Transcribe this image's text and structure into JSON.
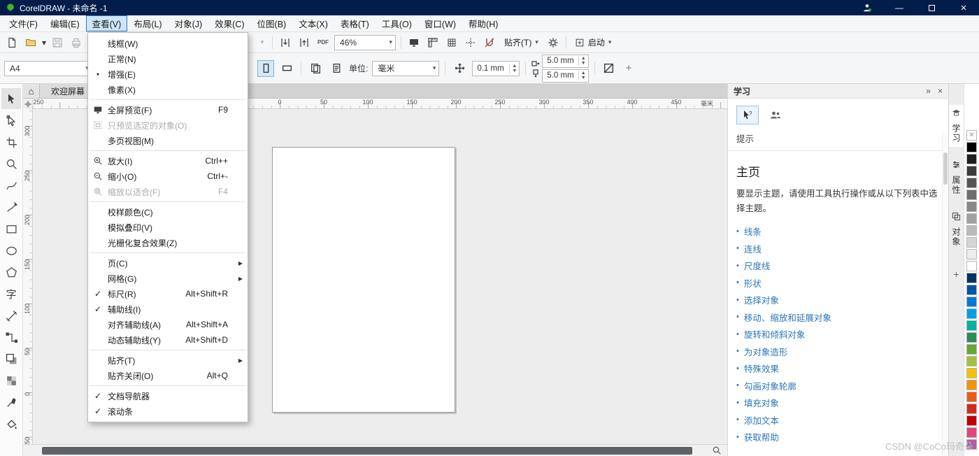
{
  "window": {
    "title": "CorelDRAW - 未命名 -1"
  },
  "glyphs": {
    "caret": "▾",
    "submenu": "▶",
    "check": "✓",
    "bullet": "●",
    "home": "⌂",
    "collapse": "»",
    "close": "×",
    "minimize": "—",
    "plus": "+",
    "swatch_none": "✕",
    "dot": "•"
  },
  "menubar": {
    "active": "查看(V)",
    "items": [
      {
        "label": "文件(F)"
      },
      {
        "label": "编辑(E)"
      },
      {
        "label": "查看(V)"
      },
      {
        "label": "布局(L)"
      },
      {
        "label": "对象(J)"
      },
      {
        "label": "效果(C)"
      },
      {
        "label": "位图(B)"
      },
      {
        "label": "文本(X)"
      },
      {
        "label": "表格(T)"
      },
      {
        "label": "工具(O)"
      },
      {
        "label": "窗口(W)"
      },
      {
        "label": "帮助(H)"
      }
    ]
  },
  "view_menu": {
    "items": [
      {
        "label": "线框(W)"
      },
      {
        "label": "正常(N)"
      },
      {
        "label": "增强(E)",
        "state": "bullet"
      },
      {
        "label": "像素(X)"
      },
      {
        "type": "sep"
      },
      {
        "label": "全屏预览(F)",
        "shortcut": "F9",
        "icon": "fullscreen"
      },
      {
        "label": "只预览选定的对象(O)",
        "icon": "preview-selected",
        "disabled": true
      },
      {
        "label": "多页视图(M)"
      },
      {
        "type": "sep"
      },
      {
        "label": "放大(I)",
        "shortcut": "Ctrl++",
        "icon": "zoom-in"
      },
      {
        "label": "缩小(O)",
        "shortcut": "Ctrl+-",
        "icon": "zoom-out"
      },
      {
        "label": "缩放以适合(F)",
        "shortcut": "F4",
        "icon": "zoom-fit",
        "disabled": true
      },
      {
        "type": "sep"
      },
      {
        "label": "校样颜色(C)"
      },
      {
        "label": "模拟叠印(V)"
      },
      {
        "label": "光栅化复合效果(Z)"
      },
      {
        "type": "sep"
      },
      {
        "label": "页(C)",
        "submenu": true
      },
      {
        "label": "网格(G)",
        "submenu": true
      },
      {
        "label": "标尺(R)",
        "shortcut": "Alt+Shift+R",
        "state": "check"
      },
      {
        "label": "辅助线(I)",
        "state": "check"
      },
      {
        "label": "对齐辅助线(A)",
        "shortcut": "Alt+Shift+A"
      },
      {
        "label": "动态辅助线(Y)",
        "shortcut": "Alt+Shift+D"
      },
      {
        "type": "sep"
      },
      {
        "label": "贴齐(T)",
        "submenu": true
      },
      {
        "label": "贴齐关闭(O)",
        "shortcut": "Alt+Q"
      },
      {
        "type": "sep"
      },
      {
        "label": "文档导航器",
        "state": "check"
      },
      {
        "label": "滚动条",
        "state": "check"
      }
    ]
  },
  "std_toolbar": {
    "zoom_value": "46%",
    "snap_label": "贴齐(T)",
    "launch_label": "启动",
    "pdf_label": "PDF"
  },
  "prop_bar": {
    "page_size": "A4",
    "units_label": "单位:",
    "units_value": "毫米",
    "nudge_value": "0.1 mm",
    "dup_x": "5.0 mm",
    "dup_y": "5.0 mm"
  },
  "doc_tabs": {
    "welcome": "欢迎屏幕"
  },
  "rulers": {
    "unit": "毫米",
    "top": [
      "250",
      "0",
      "50",
      "100",
      "150",
      "200",
      "250",
      "300",
      "350",
      "400",
      "450",
      "毫米"
    ],
    "left": [
      "300",
      "250",
      "200",
      "150",
      "100",
      "50",
      "0",
      "50"
    ]
  },
  "toolbox": [
    {
      "name": "pick-tool",
      "icon": "pick",
      "selected": true
    },
    {
      "name": "shape-tool",
      "icon": "shape"
    },
    {
      "name": "crop-tool",
      "icon": "crop"
    },
    {
      "name": "zoom-tool",
      "icon": "zoom"
    },
    {
      "name": "freehand-tool",
      "icon": "freehand"
    },
    {
      "name": "artistic-media-tool",
      "icon": "artistic"
    },
    {
      "name": "rectangle-tool",
      "icon": "rect"
    },
    {
      "name": "ellipse-tool",
      "icon": "ellipse"
    },
    {
      "name": "polygon-tool",
      "icon": "polygon"
    },
    {
      "name": "text-tool",
      "icon": "text",
      "glyph": "字"
    },
    {
      "name": "dimension-tool",
      "icon": "dimension"
    },
    {
      "name": "connector-tool",
      "icon": "connector"
    },
    {
      "name": "shadow-tool",
      "icon": "shadow"
    },
    {
      "name": "transparency-tool",
      "icon": "transparency"
    },
    {
      "name": "eyedropper-tool",
      "icon": "eyedropper"
    },
    {
      "name": "interactive-fill-tool",
      "icon": "fill"
    }
  ],
  "learn_panel": {
    "title": "学习",
    "hints_label": "提示",
    "home_title": "主页",
    "intro": "要显示主题，请使用工具执行操作或从以下列表中选择主题。",
    "links": [
      "线条",
      "连线",
      "尺度线",
      "形状",
      "选择对象",
      "移动、缩放和延展对象",
      "旋转和倾斜对象",
      "为对象造形",
      "特殊效果",
      "勾画对象轮廓",
      "填充对象",
      "添加文本",
      "获取帮助"
    ]
  },
  "side_tabs": [
    {
      "label": "学习",
      "icon": "learn-icon",
      "active": true
    },
    {
      "label": "属性",
      "icon": "properties-icon",
      "active": false
    },
    {
      "label": "对象",
      "icon": "objects-icon",
      "active": false
    }
  ],
  "palette": [
    "#000000",
    "#1f1f1f",
    "#3b3b3b",
    "#555555",
    "#6e6e6e",
    "#888888",
    "#a1a1a1",
    "#bababa",
    "#d4d4d4",
    "#ededed",
    "#ffffff",
    "#003366",
    "#0055a5",
    "#0078d4",
    "#00a0e9",
    "#00b0a0",
    "#2e8b57",
    "#66a832",
    "#a3c13a",
    "#f2c200",
    "#f29400",
    "#e85d1a",
    "#d42a1e",
    "#c00000",
    "#e0457b",
    "#b05fa0"
  ],
  "watermark": "CSDN @CoCo玛奇朵"
}
